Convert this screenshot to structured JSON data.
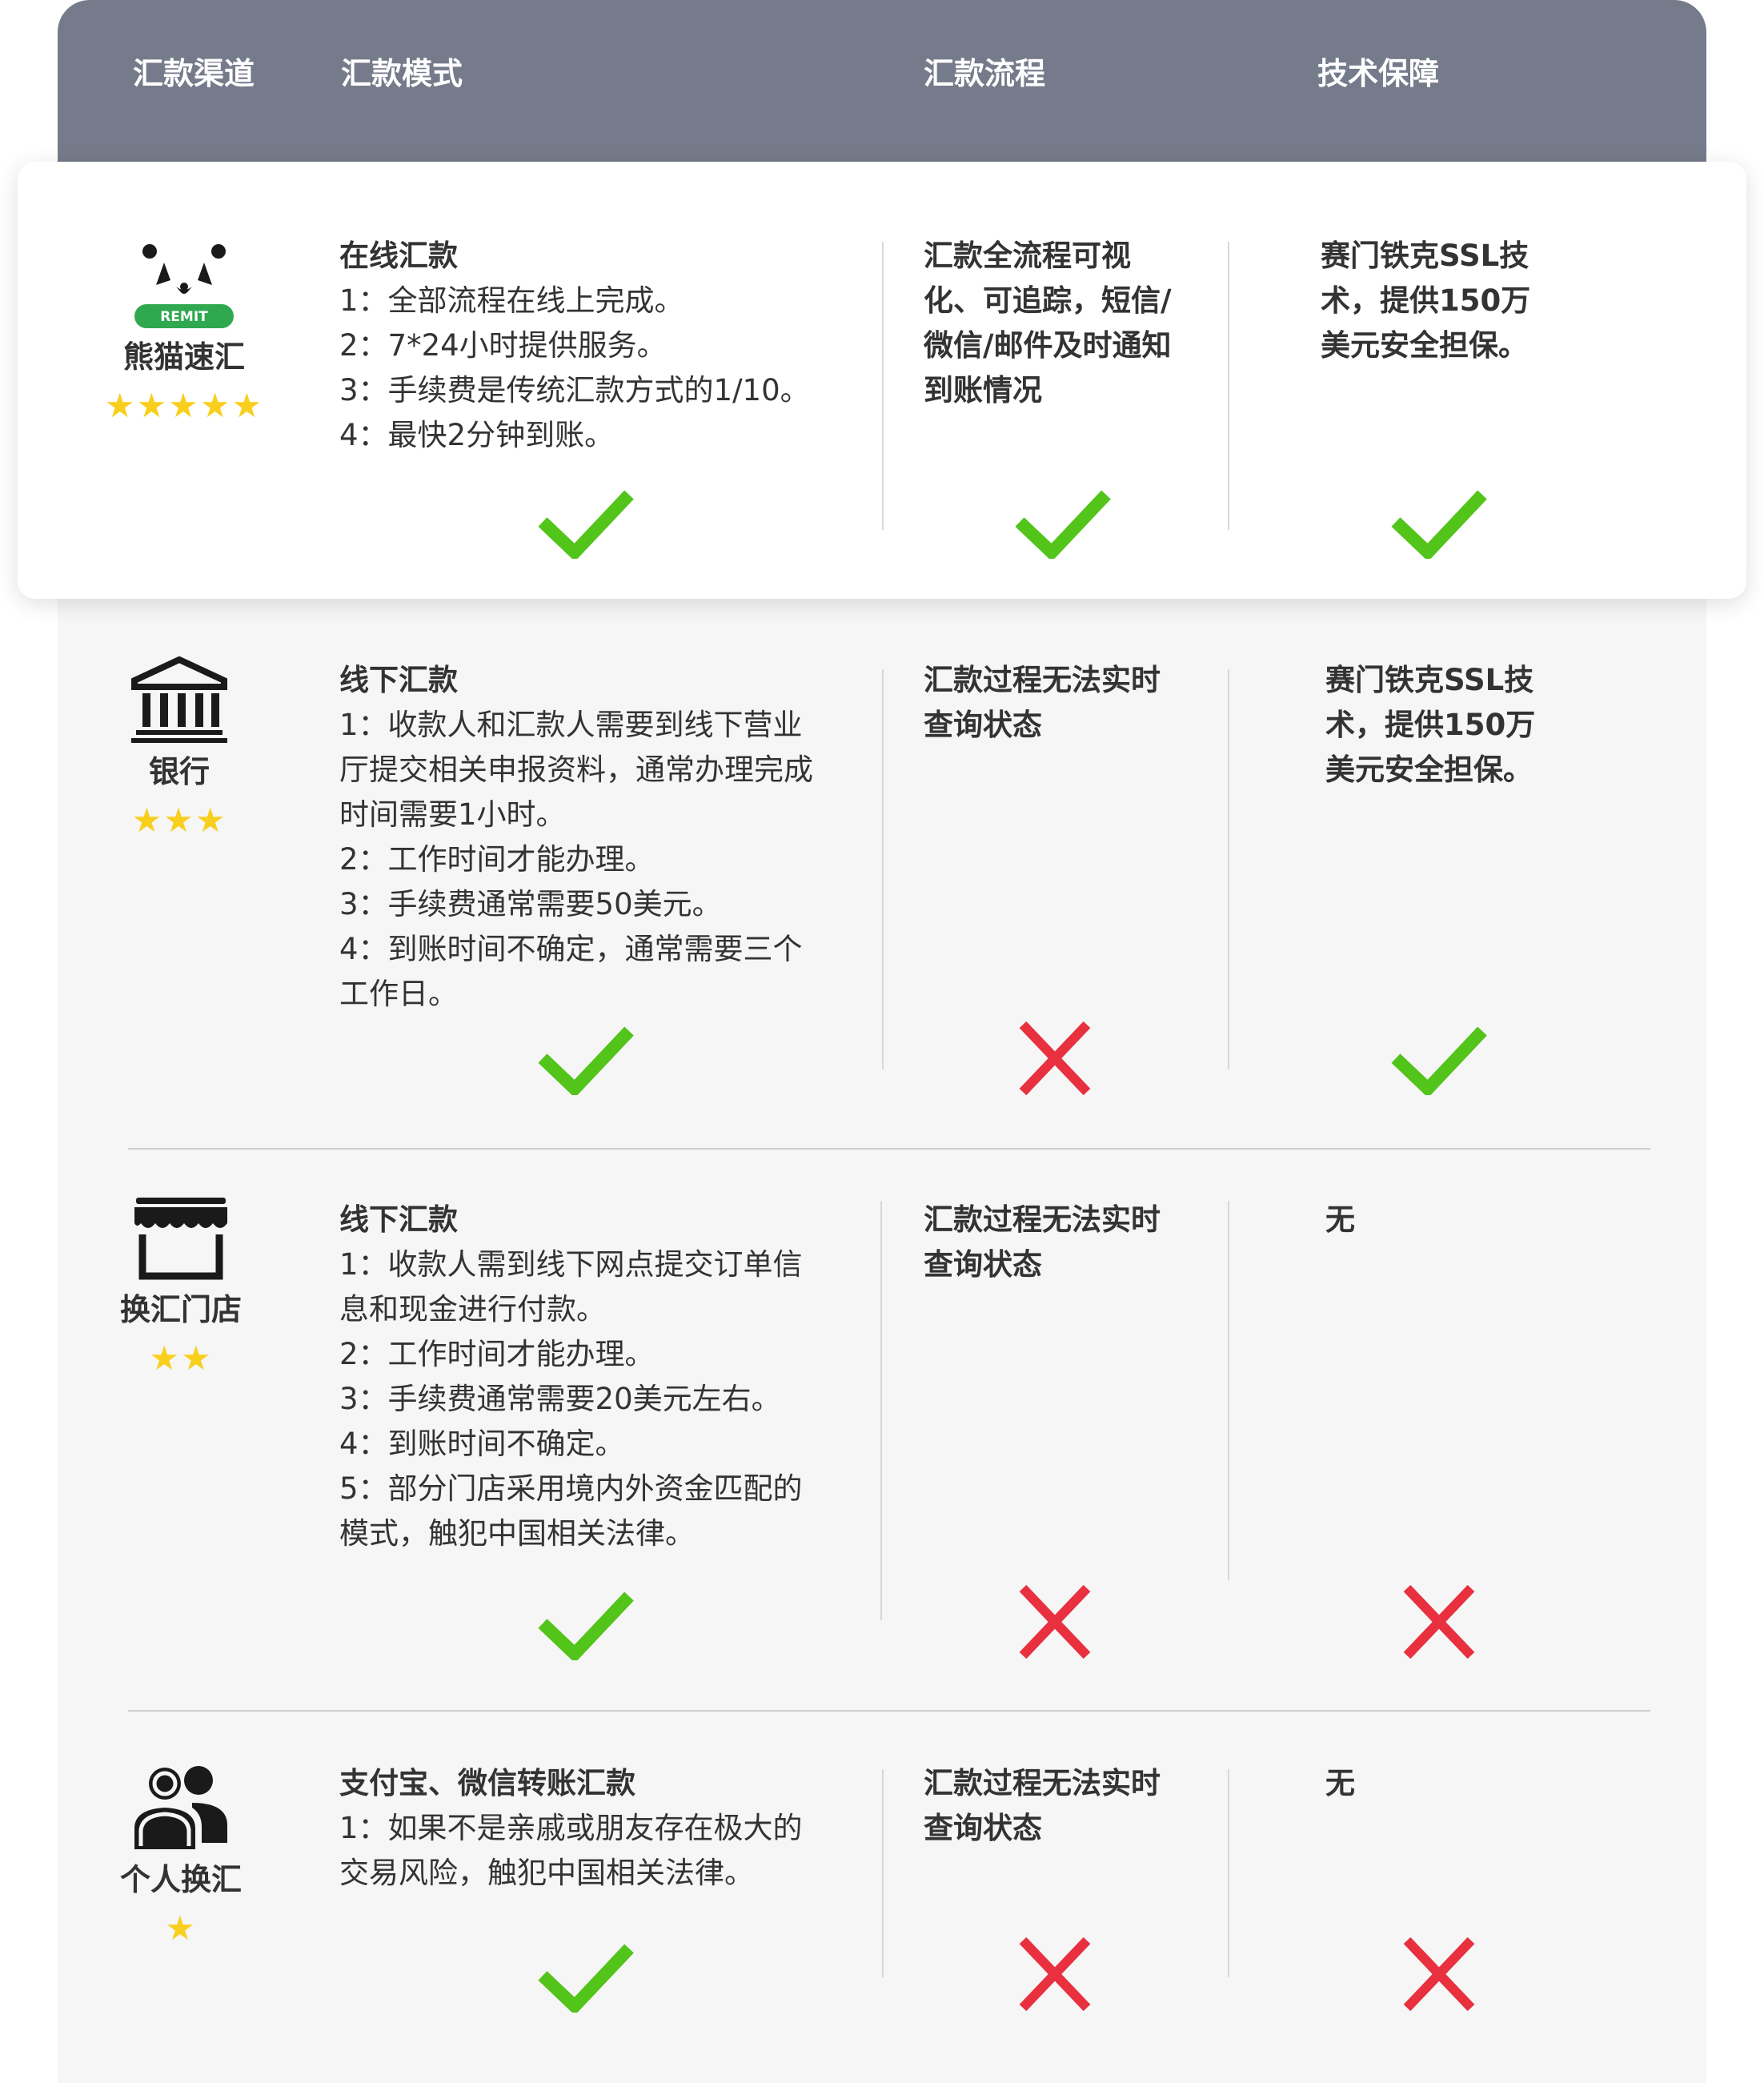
{
  "header": {
    "channel": "汇款渠道",
    "mode": "汇款模式",
    "process": "汇款流程",
    "security": "技术保障"
  },
  "rows": [
    {
      "channel": "熊猫速汇",
      "logo_text": "REMIT",
      "stars": "★★★★★",
      "rating": 5,
      "mode_title": "在线汇款",
      "mode_lines": [
        "1：全部流程在线上完成。",
        "2：7*24小时提供服务。",
        "3：手续费是传统汇款方式的1/10。",
        "4：最快2分钟到账。"
      ],
      "process_lines": [
        "汇款全流程可视",
        "化、可追踪，短信/",
        "微信/邮件及时通知",
        "到账情况"
      ],
      "security_lines": [
        "赛门铁克SSL技",
        "术，提供150万",
        "美元安全担保。"
      ],
      "marks": [
        "check-icon",
        "check-icon",
        "check-icon"
      ]
    },
    {
      "channel": "银行",
      "stars": "★★★",
      "rating": 3,
      "mode_title": "线下汇款",
      "mode_lines": [
        "1：收款人和汇款人需要到线下营业",
        "厅提交相关申报资料，通常办理完成",
        "时间需要1小时。",
        "2：工作时间才能办理。",
        "3：手续费通常需要50美元。",
        "4：到账时间不确定，通常需要三个",
        "工作日。"
      ],
      "process_lines": [
        "汇款过程无法实时",
        "查询状态"
      ],
      "security_lines": [
        "赛门铁克SSL技",
        "术，提供150万",
        "美元安全担保。"
      ],
      "marks": [
        "check-icon",
        "cross-icon",
        "check-icon"
      ]
    },
    {
      "channel": "换汇门店",
      "stars": "★★",
      "rating": 2,
      "mode_title": "线下汇款",
      "mode_lines": [
        "1：收款人需到线下网点提交订单信",
        "息和现金进行付款。",
        "2：工作时间才能办理。",
        "3：手续费通常需要20美元左右。",
        "4：到账时间不确定。",
        "5：部分门店采用境内外资金匹配的",
        "模式，触犯中国相关法律。"
      ],
      "process_lines": [
        "汇款过程无法实时",
        "查询状态"
      ],
      "security_lines": [
        "无"
      ],
      "marks": [
        "check-icon",
        "cross-icon",
        "cross-icon"
      ]
    },
    {
      "channel": "个人换汇",
      "stars": "★",
      "rating": 1,
      "mode_title": "支付宝、微信转账汇款",
      "mode_lines": [
        "1：如果不是亲戚或朋友存在极大的",
        "交易风险，触犯中国相关法律。"
      ],
      "process_lines": [
        "汇款过程无法实时",
        "查询状态"
      ],
      "security_lines": [
        "无"
      ],
      "marks": [
        "check-icon",
        "cross-icon",
        "cross-icon"
      ]
    }
  ],
  "colors": {
    "header_bg": "#767b8b",
    "check": "#52c41a",
    "cross": "#e8303f",
    "star": "#f9cf1e"
  }
}
